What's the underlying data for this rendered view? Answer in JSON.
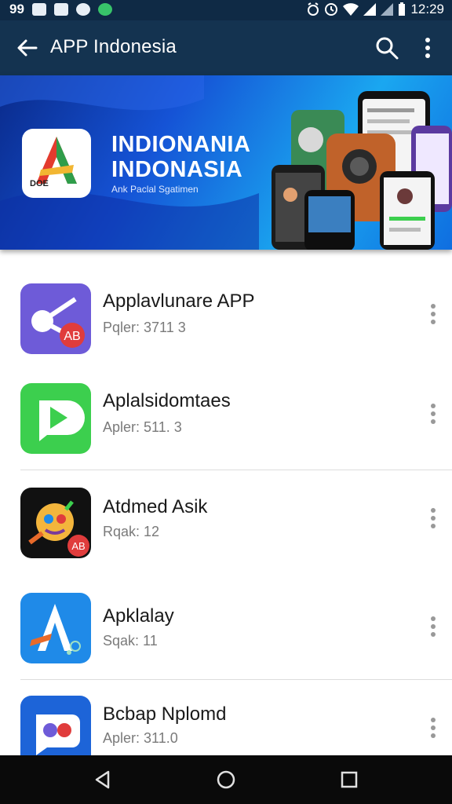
{
  "status_bar": {
    "left_text": "99",
    "time": "12:29",
    "icons": [
      "grid-icon",
      "photo-icon",
      "message-icon",
      "vpn-icon",
      "alarm-icon",
      "clock-icon",
      "wifi-icon",
      "signal-icon",
      "signal-icon",
      "battery-icon"
    ]
  },
  "app_bar": {
    "title": "APP Indonesia",
    "icons": [
      "back-arrow-icon",
      "search-icon",
      "more-vert-icon"
    ]
  },
  "banner": {
    "logo_text": "DOE",
    "heading_line1": "INDIONANIA",
    "heading_line2": "INDONASIA",
    "subtitle": "Ank Paclal Sgatimen"
  },
  "apps": [
    {
      "name": "Applavlunare APP",
      "detail": "Pqler: 3711 3",
      "icon": "app-scissors-icon",
      "icon_color": "#6e5bd8"
    },
    {
      "name": "Aplalsidomtaes",
      "detail": "Apler: 511. 3",
      "icon": "app-play-icon",
      "icon_color": "#3ccf4e"
    },
    {
      "name": "Atdmed Asik",
      "detail": "Rqak: 12",
      "icon": "app-robot-icon",
      "icon_color": "#111111"
    },
    {
      "name": "Apklalay",
      "detail": "Sqak: 11",
      "icon": "app-a-logo-icon",
      "icon_color": "#1f8ae8"
    },
    {
      "name": "Bcbap Nplomd",
      "detail": "Apler: 311.0",
      "icon": "app-chat-icon",
      "icon_color": "#1d64d8"
    }
  ],
  "nav_bar": {
    "icons": [
      "back-triangle-icon",
      "home-circle-icon",
      "recents-square-icon"
    ]
  },
  "colors": {
    "status_bar": "#0f2a45",
    "app_bar": "#143350",
    "nav_bar": "#0a0a0a"
  }
}
